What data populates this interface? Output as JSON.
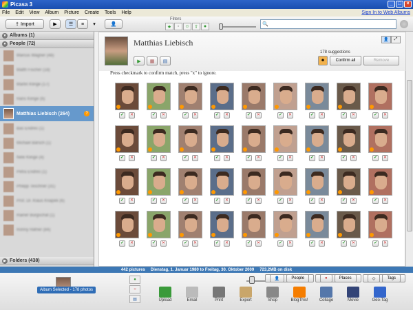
{
  "window": {
    "title": "Picasa 3"
  },
  "menu": {
    "items": [
      "File",
      "Edit",
      "View",
      "Album",
      "Picture",
      "Create",
      "Tools",
      "Help"
    ],
    "signin": "Sign In to Web Albums"
  },
  "toolbar": {
    "import": "Import",
    "filters_label": "Filters",
    "search_placeholder": ""
  },
  "sidebar": {
    "albums_header": "Albums (1)",
    "people_header": "People (72)",
    "people": [
      {
        "name": "Marcus Wagner (48)"
      },
      {
        "name": "Matth Fischer (18)"
      },
      {
        "name": "Martin Klinge (17)"
      },
      {
        "name": "Hans Klinge (6)"
      },
      {
        "name": "Matthias Liebisch (264)",
        "selected": true
      },
      {
        "name": "Bas Endres (1)"
      },
      {
        "name": "Michael Bärsch (1)"
      },
      {
        "name": "Nele Klinge (4)"
      },
      {
        "name": "Petra Endres (1)"
      },
      {
        "name": "Philipp Teschner (31)"
      },
      {
        "name": "Prof. Dr. Klaus Knapek (6)"
      },
      {
        "name": "Rainer Burgschat (1)"
      },
      {
        "name": "Ronny Häfner (84)"
      }
    ],
    "folders_header": "Folders (438)"
  },
  "person": {
    "name": "Matthias Liebisch",
    "suggestions": "178 suggestions",
    "confirm_all": "Confirm all",
    "remove": "Remove",
    "instruction": "Press checkmark to confirm match, press \"x\" to ignore."
  },
  "status": {
    "count": "442 pictures",
    "range": "Dienstag, 1. Januar 1980 to Freitag, 30. Oktober 2009",
    "size": "723,2MB on disk"
  },
  "tray": {
    "album_selected": "Album Selected - 178 photos"
  },
  "bottom_tabs": [
    "People",
    "Places",
    "Tags"
  ],
  "actions": [
    {
      "label": "Upload",
      "icon": "upload-icon",
      "color": "#3a9a3a"
    },
    {
      "label": "Email",
      "icon": "email-icon",
      "color": "#bbbbbb"
    },
    {
      "label": "Print",
      "icon": "print-icon",
      "color": "#777777"
    },
    {
      "label": "Export",
      "icon": "export-icon",
      "color": "#c9a66b"
    },
    {
      "label": "Shop",
      "icon": "shop-icon",
      "color": "#888888"
    },
    {
      "label": "BlogThis!",
      "icon": "blogger-icon",
      "color": "#f57d00"
    },
    {
      "label": "Collage",
      "icon": "collage-icon",
      "color": "#5577aa"
    },
    {
      "label": "Movie",
      "icon": "movie-icon",
      "color": "#334477"
    },
    {
      "label": "Geo-Tag",
      "icon": "geotag-icon",
      "color": "#3366cc"
    }
  ],
  "grid": {
    "rows": 4,
    "cols": 9
  }
}
